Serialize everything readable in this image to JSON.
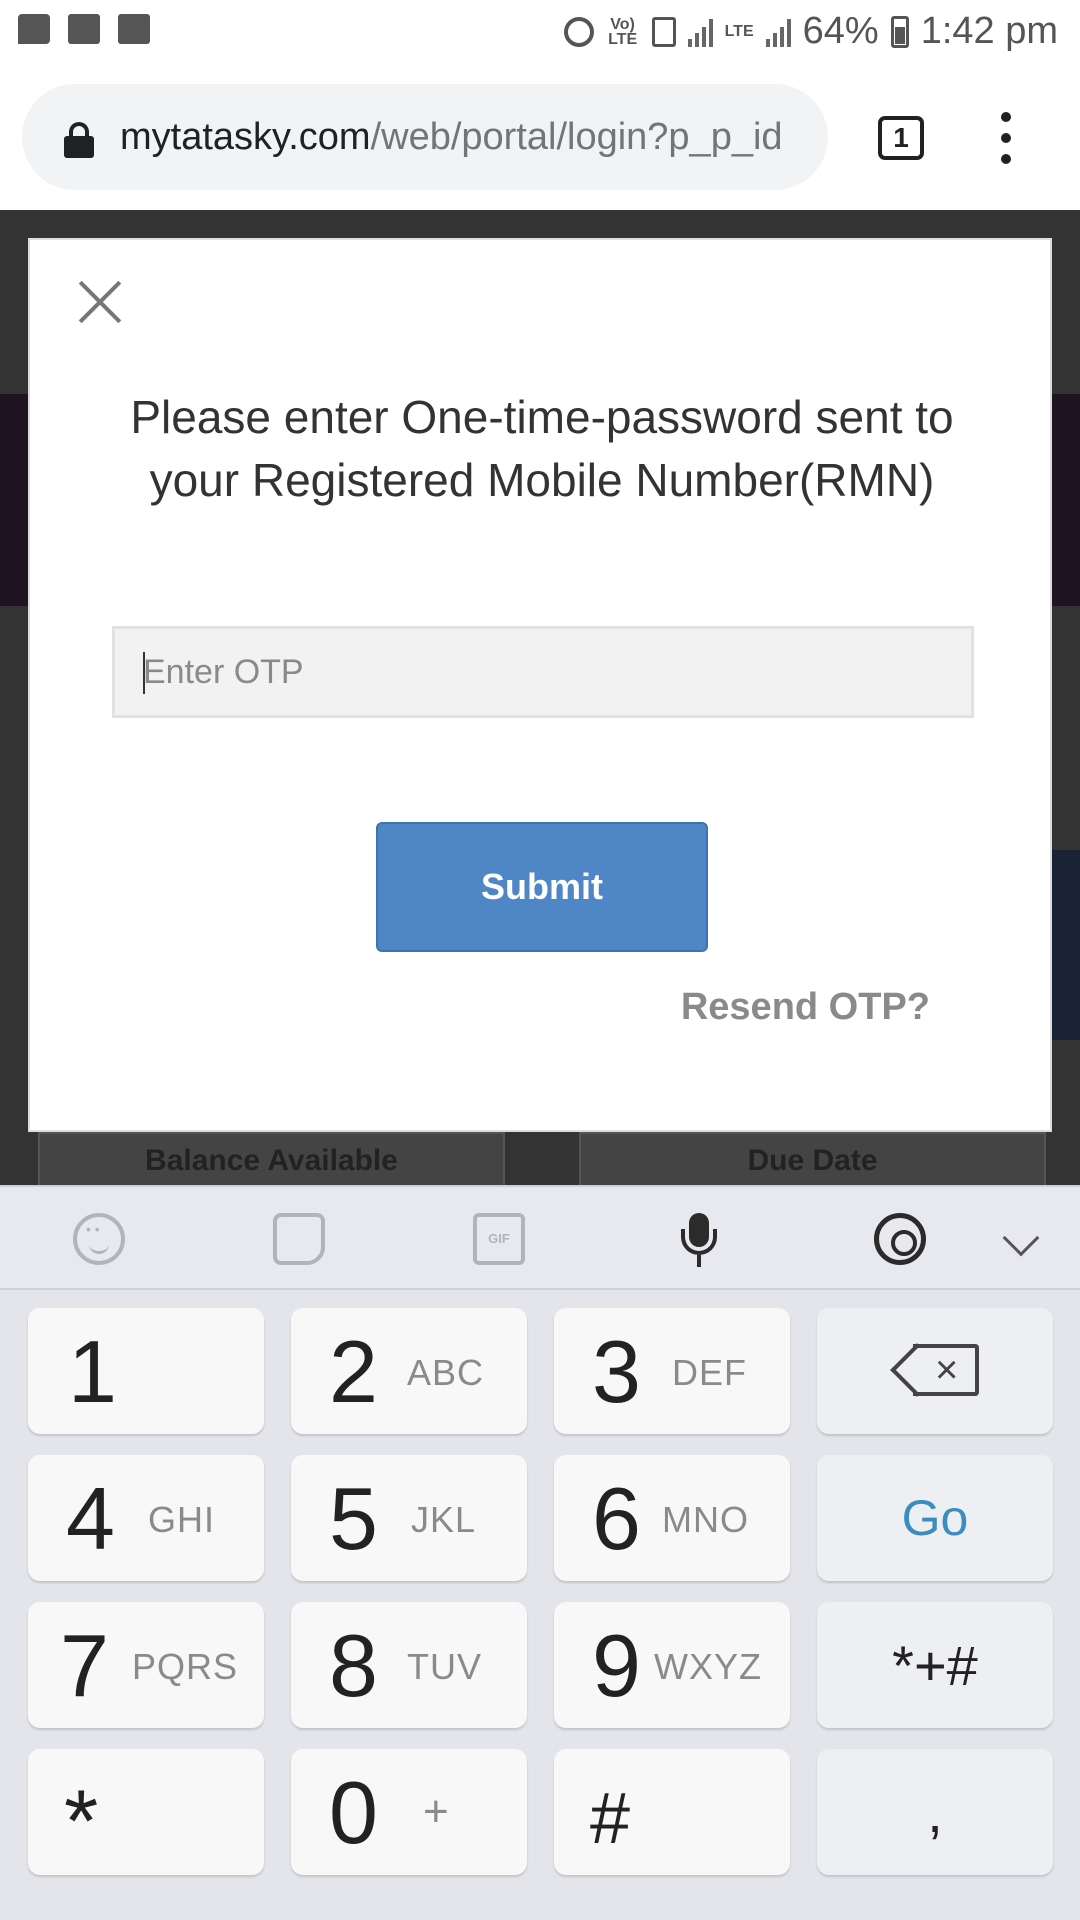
{
  "status_bar": {
    "network_label": "Vo) LTE",
    "lte_label": "LTE",
    "battery_percent": "64%",
    "time": "1:42 pm"
  },
  "browser": {
    "url_host": "mytatasky.com",
    "url_path": "/web/portal/login?p_p_id",
    "tab_count": "1"
  },
  "background_page": {
    "card_left_label": "Balance Available",
    "card_right_label": "Due Date"
  },
  "modal": {
    "message": "Please enter One-time-password sent to your Registered Mobile Number(RMN)",
    "otp_placeholder": "Enter OTP",
    "submit_label": "Submit",
    "resend_label": "Resend OTP?",
    "submit_color": "#4f86c6"
  },
  "keyboard": {
    "toolbar_icons": [
      "emoji-icon",
      "sticker-icon",
      "gif-icon",
      "microphone-icon",
      "gear-icon",
      "chevron-down-icon"
    ],
    "gif_label": "GIF",
    "keys": {
      "k1": {
        "num": "1",
        "sub": ""
      },
      "k2": {
        "num": "2",
        "sub": "ABC"
      },
      "k3": {
        "num": "3",
        "sub": "DEF"
      },
      "k4": {
        "num": "4",
        "sub": "GHI"
      },
      "k5": {
        "num": "5",
        "sub": "JKL"
      },
      "k6": {
        "num": "6",
        "sub": "MNO"
      },
      "k7": {
        "num": "7",
        "sub": "PQRS"
      },
      "k8": {
        "num": "8",
        "sub": "TUV"
      },
      "k9": {
        "num": "9",
        "sub": "WXYZ"
      },
      "k0": {
        "num": "0",
        "sub": "+"
      },
      "star": "*",
      "hash": "#",
      "go": "Go",
      "symbols": "*+#",
      "comma": ","
    }
  }
}
